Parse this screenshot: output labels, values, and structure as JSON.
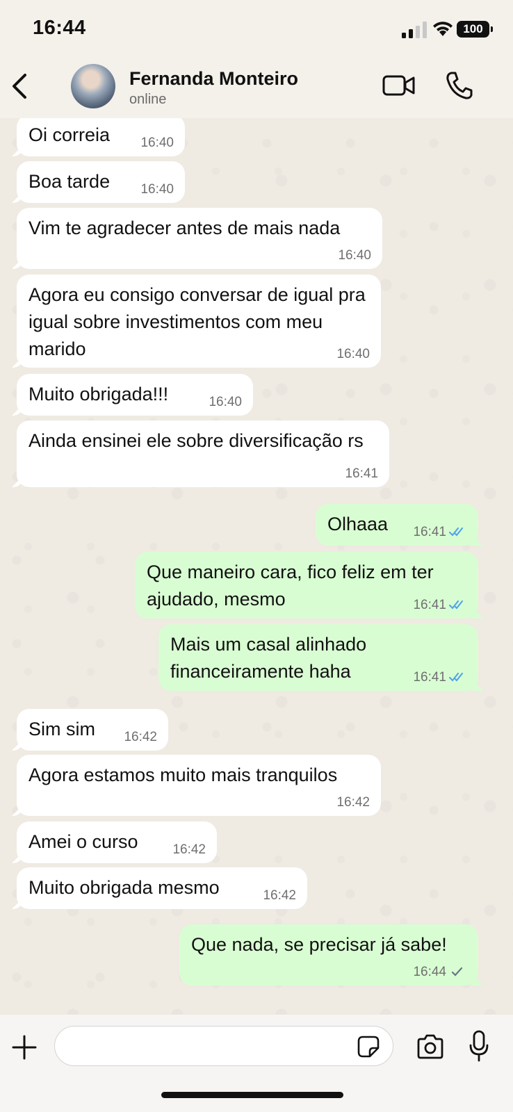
{
  "status_bar": {
    "time": "16:44",
    "battery": "100"
  },
  "header": {
    "name": "Fernanda Monteiro",
    "status": "online"
  },
  "messages": [
    {
      "text": "Oi correia",
      "time": "16:40"
    },
    {
      "text": "Boa tarde",
      "time": "16:40"
    },
    {
      "text": "Vim te agradecer antes de mais nada",
      "time": "16:40"
    },
    {
      "text": "Agora eu consigo conversar de igual pra igual sobre investimentos com meu marido",
      "time": "16:40"
    },
    {
      "text": "Muito obrigada!!!",
      "time": "16:40"
    },
    {
      "text": "Ainda ensinei ele sobre diversificação rs",
      "time": "16:41"
    },
    {
      "text": "Olhaaa",
      "time": "16:41"
    },
    {
      "text": "Que maneiro cara, fico feliz em ter ajudado, mesmo",
      "time": "16:41"
    },
    {
      "text": "Mais um casal alinhado financeiramente haha",
      "time": "16:41"
    },
    {
      "text": "Sim sim",
      "time": "16:42"
    },
    {
      "text": "Agora estamos muito mais tranquilos",
      "time": "16:42"
    },
    {
      "text": "Amei o curso",
      "time": "16:42"
    },
    {
      "text": "Muito obrigada mesmo",
      "time": "16:42"
    },
    {
      "text": "Que nada, se precisar já sabe!",
      "time": "16:44"
    }
  ],
  "input": {
    "value": ""
  },
  "colors": {
    "incoming": "#ffffff",
    "outgoing": "#d9fdd3",
    "read_ticks": "#53a6e8",
    "sent_tick": "#667781"
  }
}
